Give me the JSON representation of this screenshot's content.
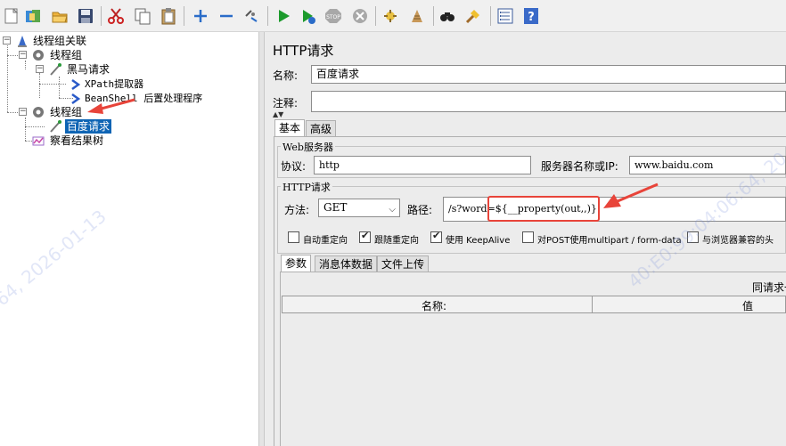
{
  "toolbar": {
    "buttons": [
      {
        "name": "new-icon"
      },
      {
        "name": "templates-icon"
      },
      {
        "name": "open-icon"
      },
      {
        "name": "save-icon"
      },
      {
        "name": "cut-icon"
      },
      {
        "name": "copy-icon"
      },
      {
        "name": "paste-icon"
      },
      {
        "name": "expand-icon"
      },
      {
        "name": "collapse-icon"
      },
      {
        "name": "toggle-icon"
      },
      {
        "name": "start-icon"
      },
      {
        "name": "start-no-pause-icon"
      },
      {
        "name": "stop-icon"
      },
      {
        "name": "shutdown-icon"
      },
      {
        "name": "clear-icon"
      },
      {
        "name": "clear-all-icon"
      },
      {
        "name": "search-icon"
      },
      {
        "name": "reset-search-icon"
      },
      {
        "name": "function-helper-icon"
      },
      {
        "name": "help-icon"
      }
    ]
  },
  "tree": {
    "root": "线程组关联",
    "thread_group_1": "线程组",
    "sampler_1": "黑马请求",
    "child_1": "XPath提取器",
    "child_2": "BeanShell 后置处理程序",
    "thread_group_2": "线程组",
    "sampler_2": "百度请求",
    "listener": "察看结果树"
  },
  "editor": {
    "title": "HTTP请求",
    "name_label": "名称:",
    "name_value": "百度请求",
    "comment_label": "注释:",
    "comment_value": "",
    "tabs": [
      "基本",
      "高级"
    ],
    "web_server_title": "Web服务器",
    "protocol_label": "协议:",
    "protocol_value": "http",
    "server_label": "服务器名称或IP:",
    "server_value": "www.baidu.com",
    "http_request_title": "HTTP请求",
    "method_label": "方法:",
    "method_value": "GET",
    "path_label": "路径:",
    "path_value": "/s?word=${__property(out,,)}",
    "checkboxes": [
      {
        "label": "自动重定向",
        "checked": false
      },
      {
        "label": "跟随重定向",
        "checked": true
      },
      {
        "label": "使用 KeepAlive",
        "checked": true
      },
      {
        "label": "对POST使用multipart / form-data",
        "checked": false
      },
      {
        "label": "与浏览器兼容的头",
        "checked": false
      }
    ],
    "sub_tabs": [
      "参数",
      "消息体数据",
      "文件上传"
    ],
    "send_with_request": "同请求一",
    "columns": [
      "名称:",
      "值"
    ]
  },
  "watermark": {
    "left": "64, 2026-01-13",
    "right": "40:E0:99:04:06:64, 20"
  },
  "colors": {
    "selection": "#0e64b4",
    "annotation": "#e8443a"
  }
}
